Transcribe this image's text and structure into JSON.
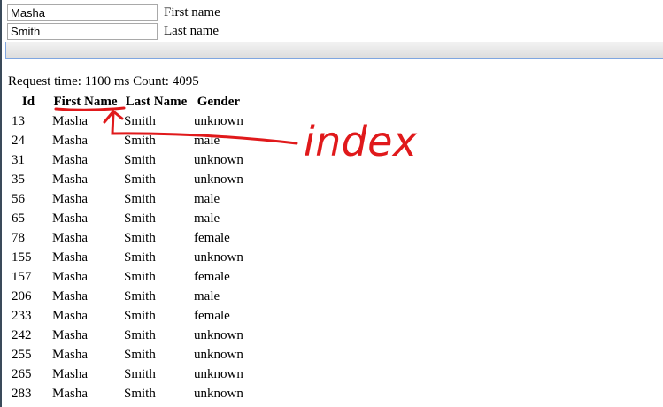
{
  "form": {
    "first_name_value": "Masha",
    "first_name_label": "First name",
    "last_name_value": "Smith",
    "last_name_label": "Last name",
    "submit_label": ""
  },
  "status": "Request time: 1100 ms Count: 4095",
  "table": {
    "headers": [
      "Id",
      "First Name",
      "Last Name",
      "Gender"
    ],
    "rows": [
      [
        "13",
        "Masha",
        "Smith",
        "unknown"
      ],
      [
        "24",
        "Masha",
        "Smith",
        "male"
      ],
      [
        "31",
        "Masha",
        "Smith",
        "unknown"
      ],
      [
        "35",
        "Masha",
        "Smith",
        "unknown"
      ],
      [
        "56",
        "Masha",
        "Smith",
        "male"
      ],
      [
        "65",
        "Masha",
        "Smith",
        "male"
      ],
      [
        "78",
        "Masha",
        "Smith",
        "female"
      ],
      [
        "155",
        "Masha",
        "Smith",
        "unknown"
      ],
      [
        "157",
        "Masha",
        "Smith",
        "female"
      ],
      [
        "206",
        "Masha",
        "Smith",
        "male"
      ],
      [
        "233",
        "Masha",
        "Smith",
        "female"
      ],
      [
        "242",
        "Masha",
        "Smith",
        "unknown"
      ],
      [
        "255",
        "Masha",
        "Smith",
        "unknown"
      ],
      [
        "265",
        "Masha",
        "Smith",
        "unknown"
      ],
      [
        "283",
        "Masha",
        "Smith",
        "unknown"
      ]
    ]
  },
  "annotation": {
    "text": "index",
    "color": "#e0191b"
  }
}
